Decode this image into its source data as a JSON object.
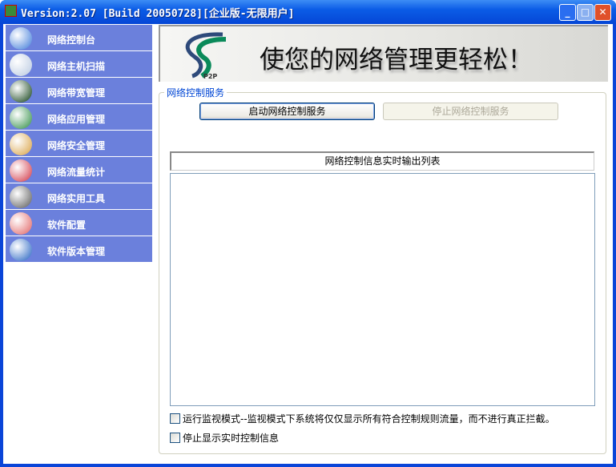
{
  "title": "Version:2.07 [Build 20050728][企业版-无限用户]",
  "sidebar": {
    "items": [
      {
        "label": "网络控制台",
        "icon": "globe-icon",
        "color": "#3a78d8"
      },
      {
        "label": "网络主机扫描",
        "icon": "computer-icon",
        "color": "#b8c8e0"
      },
      {
        "label": "网络带宽管理",
        "icon": "monitor-icon",
        "color": "#0a3a10"
      },
      {
        "label": "网络应用管理",
        "icon": "windows-globe-icon",
        "color": "#2a8a40"
      },
      {
        "label": "网络安全管理",
        "icon": "keys-icon",
        "color": "#d8a040"
      },
      {
        "label": "网络流量统计",
        "icon": "bar-chart-icon",
        "color": "#d03040"
      },
      {
        "label": "网络实用工具",
        "icon": "tools-icon",
        "color": "#555555"
      },
      {
        "label": "软件配置",
        "icon": "gear-icon",
        "color": "#e06060"
      },
      {
        "label": "软件版本管理",
        "icon": "help-icon",
        "color": "#1f5fc0"
      }
    ]
  },
  "banner": {
    "slogan": "使您的网络管理更轻松！",
    "logo": "P2P"
  },
  "group": {
    "label": "网络控制服务",
    "start": "启动网络控制服务",
    "stop": "停止网络控制服务",
    "list_header": "网络控制信息实时输出列表",
    "monitor_mode": "运行监视模式--监视模式下系统将仅仅显示所有符合控制规则流量，而不进行真正拦截。",
    "stop_display": "停止显示实时控制信息"
  }
}
